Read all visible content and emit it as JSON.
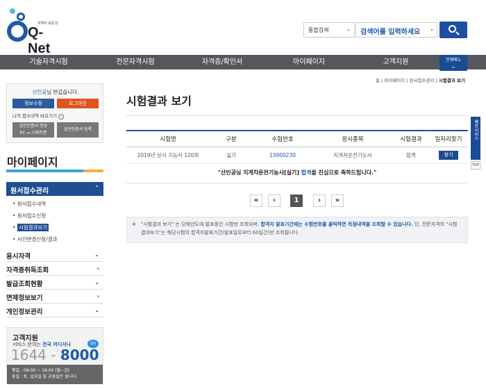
{
  "header": {
    "logo_sub": "자격의 모든것",
    "logo_text": "Q-Net",
    "search_scope": "통합검색",
    "search_placeholder": "검색어를 입력하세요"
  },
  "nav": {
    "items": [
      "기술자격시험",
      "전문자격시험",
      "자격증/확인서",
      "마이페이지",
      "고객지원"
    ],
    "all_menu": "전체메뉴"
  },
  "breadcrumb": {
    "home": "홈",
    "sep": "|",
    "level1": "마이페이지",
    "level2": "원서접수관리",
    "current": "시험결과 보기"
  },
  "sidebar": {
    "user_name": "산인공",
    "greeting": "님 반갑습니다.",
    "btn_info": "정보수정",
    "btn_logout": "로그아웃",
    "my_status": "나의 접수내역 바로가기",
    "btn_cert_line1": "공인인증서 전송",
    "btn_cert_line2": "PC ↔ 스마트폰",
    "btn_cert_reg": "공인인증서 등록",
    "title": "마이페이지",
    "section_apply": "원서접수관리",
    "sub_items": [
      "원서접수내역",
      "원서접수신청",
      "시험결과보기",
      "사진변경신청/결과"
    ],
    "menus": [
      "응시자격",
      "자격증취득조회",
      "발급조회현황",
      "면제정보보기",
      "개인정보관리"
    ],
    "support_title": "고객지원",
    "support_desc": "서비스 문의는",
    "support_desc_hl": "전국 어디서나",
    "support_go": "Go",
    "phone_a": "1644 - ",
    "phone_b": "8000",
    "hours_line1": "평일 : 09:00 ~ 18:00 (월~금)",
    "hours_line2": "휴일 : 토, 일요일 및 공휴일은 쉽니다."
  },
  "main": {
    "title": "시험결과 보기",
    "columns": [
      "시험명",
      "구분",
      "수험번호",
      "응시종목",
      "시험결과",
      "일자리찾기"
    ],
    "row": {
      "exam": "2019년 상시 기능사 120회",
      "type": "실기",
      "number": "13900230",
      "subject": "지게차운전기능사",
      "result": "합격",
      "find": "찾기"
    },
    "congrats_a": "\"산인공님 지게차운전기능사[실기] ",
    "congrats_hl": "합격",
    "congrats_b": "을 진심으로 축하드립니다.\"",
    "pagination": {
      "first": "«",
      "prev": "‹",
      "current": "1",
      "next": "›",
      "last": "»"
    },
    "notice_mark": "※",
    "notice_a": "\"시험결과 보기\" 는 당해년도에 발표중인 시험만 조회되며, ",
    "notice_hl": "합격자 발표기간에는 수험번호를 클릭하면 득점내역을 조회할 수 있습니다.",
    "notice_b": " 단, 전문자격의 \"시험결과보기\"는 해당시험의 합격자발표기간(발표일로부터 60일간)만 조회됩니다."
  },
  "quick": {
    "label": "빠른서비스",
    "top": "TOP"
  }
}
